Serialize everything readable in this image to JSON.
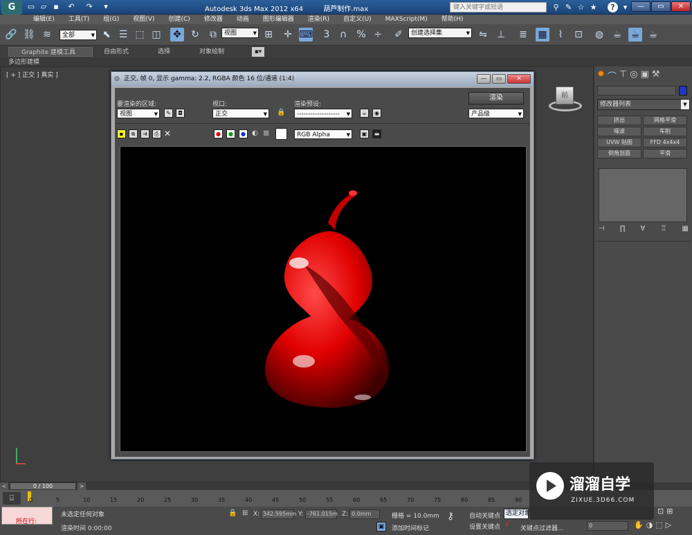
{
  "titlebar": {
    "app": "Autodesk 3ds Max  2012 x64",
    "file": "葫芦制作.max",
    "search_placeholder": "键入关键字或短语",
    "logo": "3ds-max-logo",
    "window_buttons": [
      "—",
      "▭",
      "✕"
    ]
  },
  "menu": [
    "编辑(E)",
    "工具(T)",
    "组(G)",
    "视图(V)",
    "创建(C)",
    "修改器",
    "动画",
    "图形编辑器",
    "渲染(R)",
    "自定义(U)",
    "MAXScript(M)",
    "帮助(H)"
  ],
  "toolbar": {
    "selection_filter": "全部",
    "ref_coord": "视图",
    "named_selection": "创建选择集"
  },
  "ribbon": {
    "tabs": [
      "Graphite 建模工具",
      "自由形式",
      "选择",
      "对象绘制"
    ],
    "sub": "多边形建模"
  },
  "viewport": {
    "label": "[ + ] 正交 ] 真实 ]",
    "viewcube_face": "前"
  },
  "command_panel": {
    "modifier_list": "修改器列表",
    "buttons": [
      "挤出",
      "网格平滑",
      "噪波",
      "车削",
      "UVW 贴图",
      "FFD 4x4x4",
      "倒角剖面",
      "平滑"
    ]
  },
  "render_window": {
    "title": "正交, 帧 0, 显示 gamma: 2.2, RGBA 颜色 16 位/通道 (1:4)",
    "area_label": "要渲染的区域:",
    "area_value": "视图",
    "viewport_label": "视口:",
    "viewport_value": "正交",
    "preset_label": "渲染预设:",
    "preset_value": "-------------------",
    "render_button": "渲染",
    "quality_value": "产品级",
    "channel_value": "RGB Alpha",
    "colors": {
      "red": "#e00000",
      "green": "#00a000",
      "blue": "#1030d0",
      "gourd": "#e00000"
    }
  },
  "timeline": {
    "slider": "0 / 100",
    "ticks": [
      "0",
      "5",
      "10",
      "15",
      "20",
      "25",
      "30",
      "35",
      "40",
      "45",
      "50",
      "55",
      "60",
      "65",
      "70",
      "75",
      "80",
      "85",
      "90"
    ]
  },
  "status": {
    "running": "所在行:",
    "no_selection": "未选定任何对象",
    "render_time": "渲染时间  0:00:00",
    "x_label": "X:",
    "x_value": "342.595mm",
    "y_label": "Y:",
    "y_value": "-761.015m",
    "z_label": "Z:",
    "z_value": "0.0mm",
    "grid": "栅格 = 10.0mm",
    "add_time_tag": "添加时间标记",
    "auto_key": "自动关键点",
    "selected": "选定对象",
    "set_key": "设置关键点",
    "key_filter": "关键点过滤器...",
    "frame": "0"
  },
  "watermark": {
    "brand": "溜溜自学",
    "url": "ZIXUE.3D66.COM"
  }
}
